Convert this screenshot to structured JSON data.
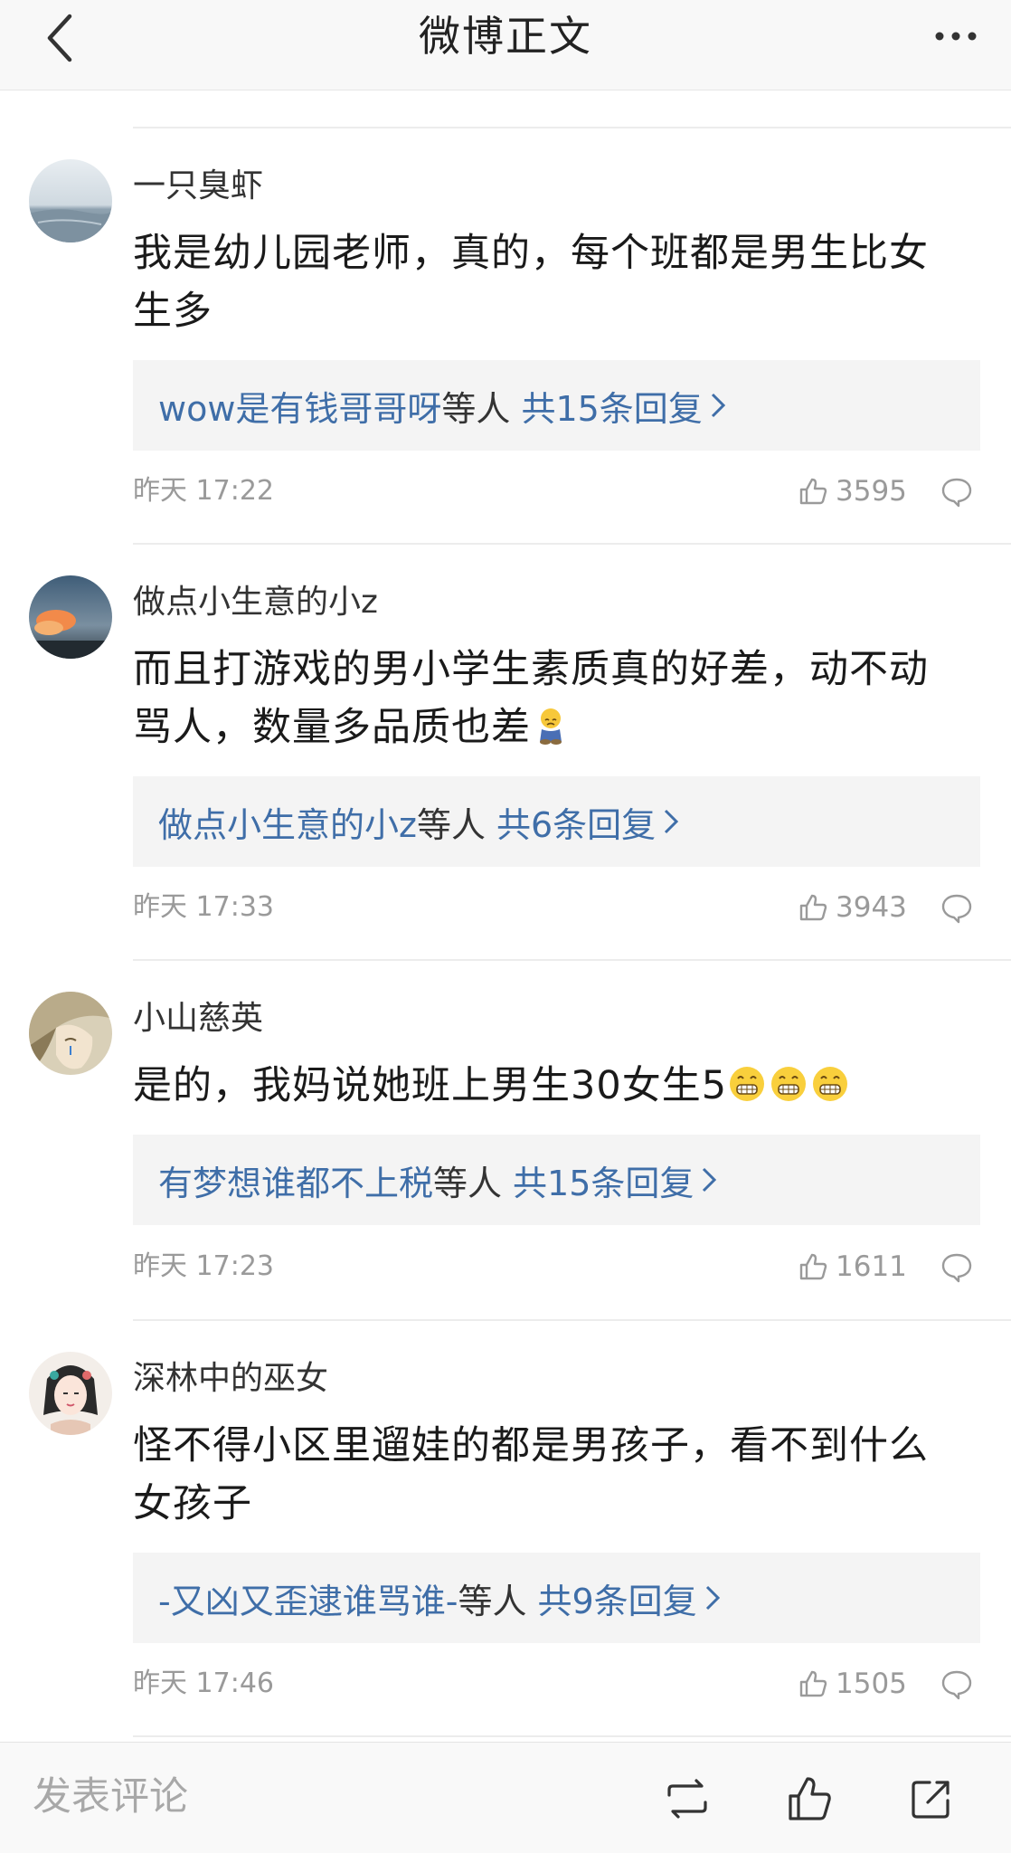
{
  "header": {
    "title": "微博正文",
    "back_icon": "chevron-left-icon",
    "more_icon": "more-dots-icon"
  },
  "comments": [
    {
      "username": "一只臭虾",
      "avatar": "avatar-sea",
      "content_lines": [
        "我是幼儿园老师，真的，每个班都是男生比女",
        "生多"
      ],
      "reply_user": "wow是有钱哥哥呀",
      "reply_suffix": "等人",
      "reply_total": "共15条回复",
      "time": "昨天 17:22",
      "likes": "3595"
    },
    {
      "username": "做点小生意的小z",
      "avatar": "avatar-sunset",
      "content_lines": [
        "而且打游戏的男小学生素质真的好差，动不动",
        "骂人，数量多品质也差"
      ],
      "content_emoji": "sad-emoji",
      "reply_user": "做点小生意的小z",
      "reply_suffix": "等人",
      "reply_total": "共6条回复",
      "time": "昨天 17:33",
      "likes": "3943"
    },
    {
      "username": "小山慈英",
      "avatar": "avatar-illustration",
      "content_lines": [
        "是的，我妈说她班上男生30女生5"
      ],
      "content_emoji": "grin-emoji",
      "reply_user": "有梦想谁都不上税",
      "reply_suffix": "等人",
      "reply_total": "共15条回复",
      "time": "昨天 17:23",
      "likes": "1611"
    },
    {
      "username": "深林中的巫女",
      "avatar": "avatar-girl",
      "content_lines": [
        "怪不得小区里遛娃的都是男孩子，看不到什么",
        "女孩子"
      ],
      "reply_user": "-又凶又歪逮谁骂谁-",
      "reply_suffix": "等人",
      "reply_total": "共9条回复",
      "time": "昨天 17:46",
      "likes": "1505"
    }
  ],
  "bottom_bar": {
    "placeholder": "发表评论",
    "repost_icon": "repost-icon",
    "like_icon": "thumbs-up-icon",
    "share_icon": "share-icon"
  },
  "colors": {
    "link_blue": "#3f6ea8",
    "meta_gray": "#9a9a9a",
    "reply_bg": "#f4f4f4"
  }
}
